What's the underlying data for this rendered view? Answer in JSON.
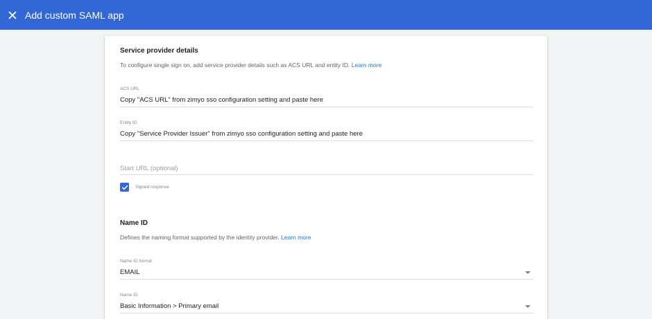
{
  "topbar": {
    "close_icon": "close-icon",
    "title": "Add custom SAML app",
    "color": "#3367d6"
  },
  "sp_details": {
    "title": "Service provider details",
    "description": "To configure single sign on, add service provider details such as ACS URL and entity ID.",
    "learn_more": "Learn more",
    "acs_url": {
      "label": "ACS URL",
      "value": "Copy \"ACS URL\" from zimyo sso configuration setting and paste here"
    },
    "entity_id": {
      "label": "Entity ID",
      "value": "Copy \"Service Provider Issuer\"  from zimyo sso configuration setting and paste here"
    },
    "start_url": {
      "placeholder": "Start URL (optional)"
    },
    "signed_response": {
      "label": "Signed response",
      "checked": true
    }
  },
  "name_id_section": {
    "title": "Name ID",
    "description": "Defines the naming format supported by the identity provider.",
    "learn_more": "Learn more",
    "format": {
      "label": "Name ID format",
      "value": "EMAIL"
    },
    "name_id": {
      "label": "Name ID",
      "value": "Basic Information > Primary email"
    }
  }
}
